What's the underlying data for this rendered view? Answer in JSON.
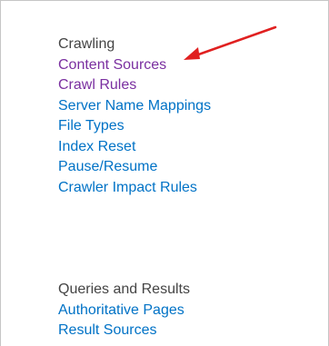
{
  "crawling": {
    "heading": "Crawling",
    "links": [
      {
        "label": "Content Sources",
        "state": "visited"
      },
      {
        "label": "Crawl Rules",
        "state": "visited"
      },
      {
        "label": "Server Name Mappings",
        "state": "unvisited"
      },
      {
        "label": "File Types",
        "state": "unvisited"
      },
      {
        "label": "Index Reset",
        "state": "unvisited"
      },
      {
        "label": "Pause/Resume",
        "state": "unvisited"
      },
      {
        "label": "Crawler Impact Rules",
        "state": "unvisited"
      }
    ]
  },
  "queries": {
    "heading": "Queries and Results",
    "links": [
      {
        "label": "Authoritative Pages",
        "state": "unvisited"
      },
      {
        "label": "Result Sources",
        "state": "unvisited"
      }
    ]
  },
  "annotation": {
    "arrow_color": "#e02020",
    "arrow_target": "Content Sources"
  },
  "colors": {
    "heading": "#444444",
    "link": "#0072c6",
    "visited_link": "#7a2fa0",
    "border": "#c6c6c6"
  }
}
